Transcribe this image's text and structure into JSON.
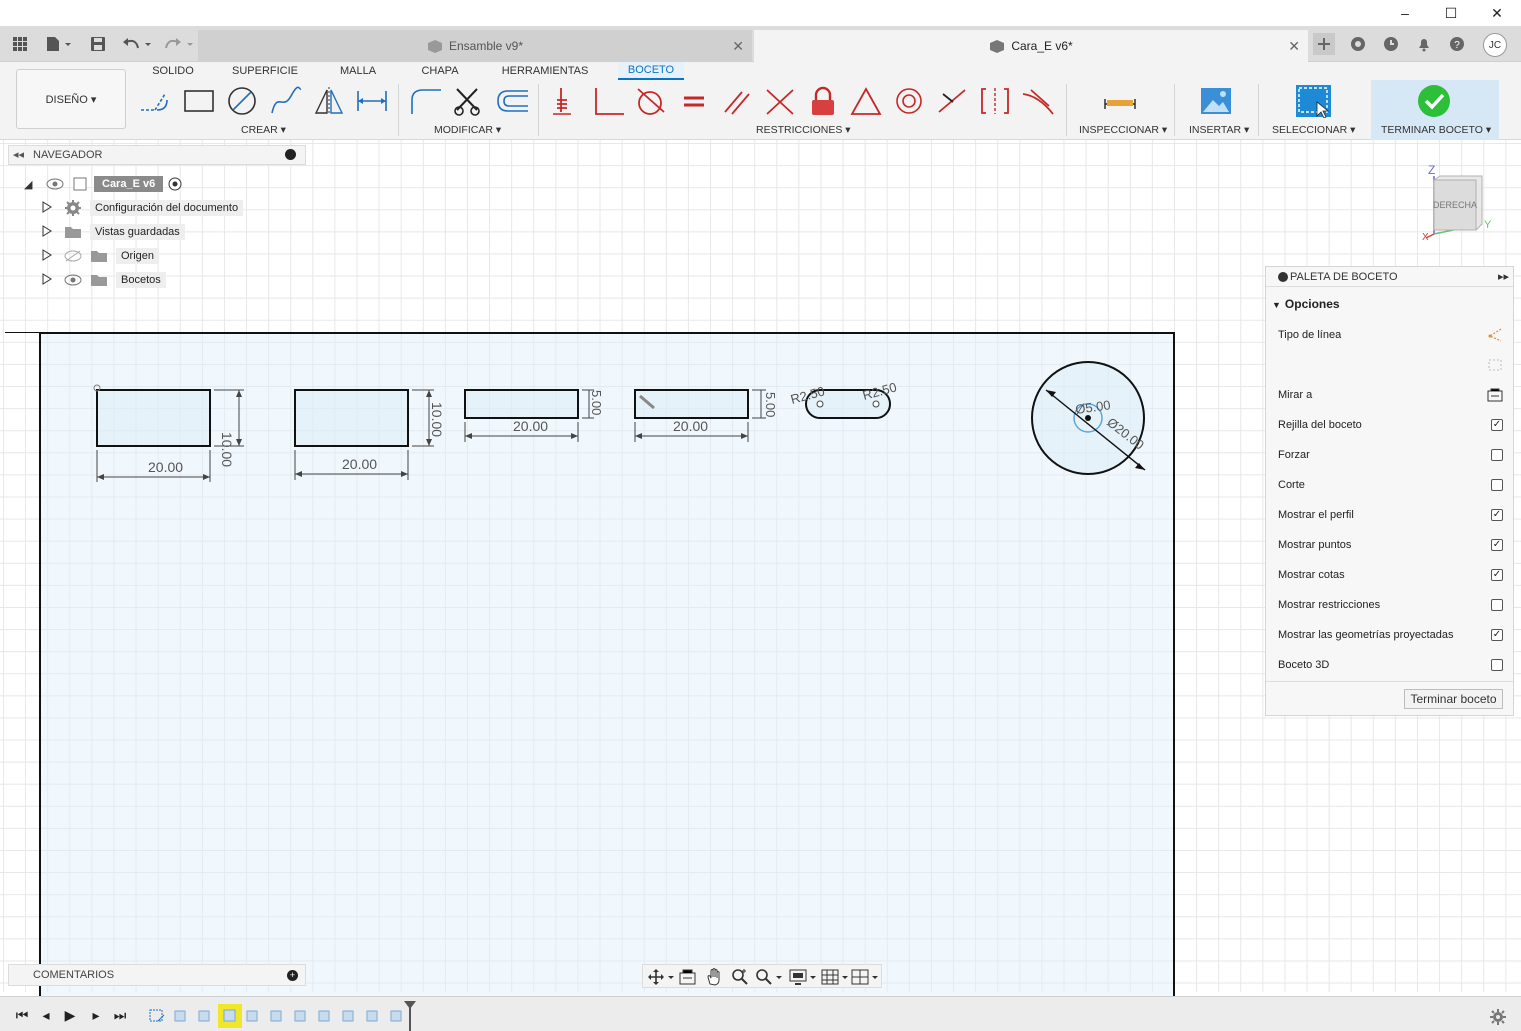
{
  "window": {
    "minimize": "–",
    "maximize": "☐",
    "close": "✕"
  },
  "tabs": [
    {
      "title": "Ensamble v9*",
      "active": false
    },
    {
      "title": "Cara_E v6*",
      "active": true
    }
  ],
  "user": {
    "initials": "JC"
  },
  "ribbon": {
    "workspace": "DISEÑO ▾",
    "tabs": [
      "SOLIDO",
      "SUPERFICIE",
      "MALLA",
      "CHAPA",
      "HERRAMIENTAS",
      "BOCETO"
    ],
    "active_tab": "BOCETO",
    "groups": {
      "crear": "CREAR ▾",
      "modificar": "MODIFICAR ▾",
      "restricciones": "RESTRICCIONES ▾",
      "inspeccionar": "INSPECCIONAR ▾",
      "insertar": "INSERTAR ▾",
      "seleccionar": "SELECCIONAR ▾",
      "terminar": "TERMINAR BOCETO ▾"
    }
  },
  "navigator": {
    "title": "NAVEGADOR",
    "root": "Cara_E v6",
    "items": [
      "Configuración del documento",
      "Vistas guardadas",
      "Origen",
      "Bocetos"
    ]
  },
  "sketch": {
    "dims": {
      "r1_w": "20.00",
      "r1_h": "10.00",
      "r2_w": "20.00",
      "r2_h": "10.00",
      "r3_w": "20.00",
      "r3_h": "5.00",
      "r4_w": "20.00",
      "r4_h": "5.00",
      "slot_r1": "R2.50",
      "slot_r2": "R2.50",
      "circle_inner": "Ø5.00",
      "circle_outer": "Ø20.00"
    }
  },
  "viewcube": {
    "face": "DERECHA",
    "z": "Z",
    "y": "Y",
    "x": "X"
  },
  "palette": {
    "title": "PALETA DE BOCETO",
    "section": "Opciones",
    "rows": [
      {
        "label": "Tipo de línea",
        "type": "icon",
        "icon": "linetype-icon"
      },
      {
        "label": "",
        "type": "icon",
        "icon": "construction-icon"
      },
      {
        "label": "Mirar a",
        "type": "icon",
        "icon": "look-at-icon"
      },
      {
        "label": "Rejilla del boceto",
        "type": "check",
        "checked": true
      },
      {
        "label": "Forzar",
        "type": "check",
        "checked": false
      },
      {
        "label": "Corte",
        "type": "check",
        "checked": false
      },
      {
        "label": "Mostrar el perfil",
        "type": "check",
        "checked": true
      },
      {
        "label": "Mostrar puntos",
        "type": "check",
        "checked": true
      },
      {
        "label": "Mostrar cotas",
        "type": "check",
        "checked": true
      },
      {
        "label": "Mostrar restricciones",
        "type": "check",
        "checked": false
      },
      {
        "label": "Mostrar las geometrías proyectadas",
        "type": "check",
        "checked": true
      },
      {
        "label": "Boceto 3D",
        "type": "check",
        "checked": false
      }
    ],
    "finish_button": "Terminar boceto"
  },
  "comments": {
    "title": "COMENTARIOS"
  },
  "colors": {
    "accent": "#0a74c4",
    "finish_green": "#2dbf3a",
    "constraint_red": "#c62828"
  }
}
